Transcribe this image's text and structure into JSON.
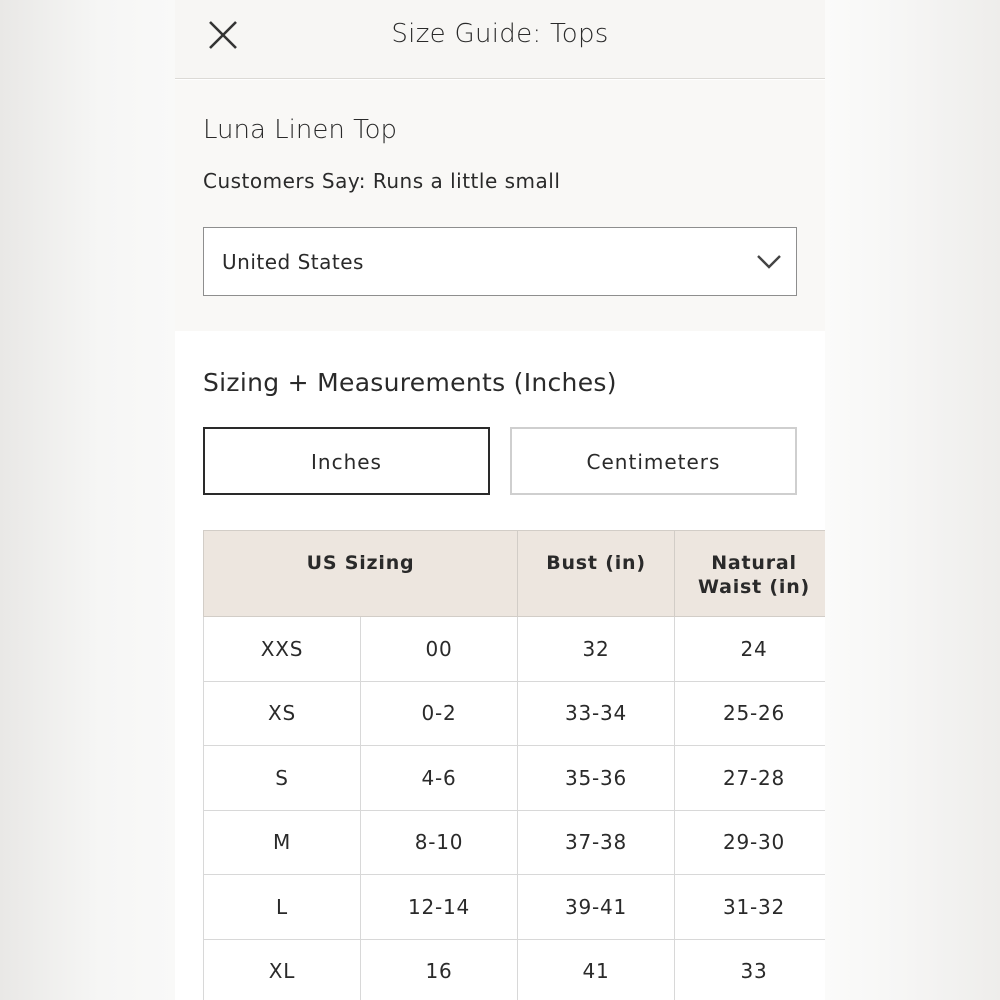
{
  "header": {
    "title": "Size Guide: Tops",
    "close_icon": "close-icon"
  },
  "product": {
    "name": "Luna Linen Top",
    "fit_note": "Customers Say: Runs a little small"
  },
  "country_select": {
    "value": "United States",
    "icon": "chevron-down-icon"
  },
  "measurements": {
    "title": "Sizing + Measurements (Inches)",
    "unit_buttons": [
      "Inches",
      "Centimeters"
    ],
    "selected_unit": "Inches"
  },
  "table": {
    "headers": {
      "us_sizing": "US Sizing",
      "bust": "Bust (in)",
      "waist_line1": "Natural",
      "waist_line2": "Waist (in)"
    },
    "rows": [
      [
        "XXS",
        "00",
        "32",
        "24"
      ],
      [
        "XS",
        "0-2",
        "33-34",
        "25-26"
      ],
      [
        "S",
        "4-6",
        "35-36",
        "27-28"
      ],
      [
        "M",
        "8-10",
        "37-38",
        "29-30"
      ],
      [
        "L",
        "12-14",
        "39-41",
        "31-32"
      ],
      [
        "XL",
        "16",
        "41",
        "33"
      ]
    ]
  }
}
